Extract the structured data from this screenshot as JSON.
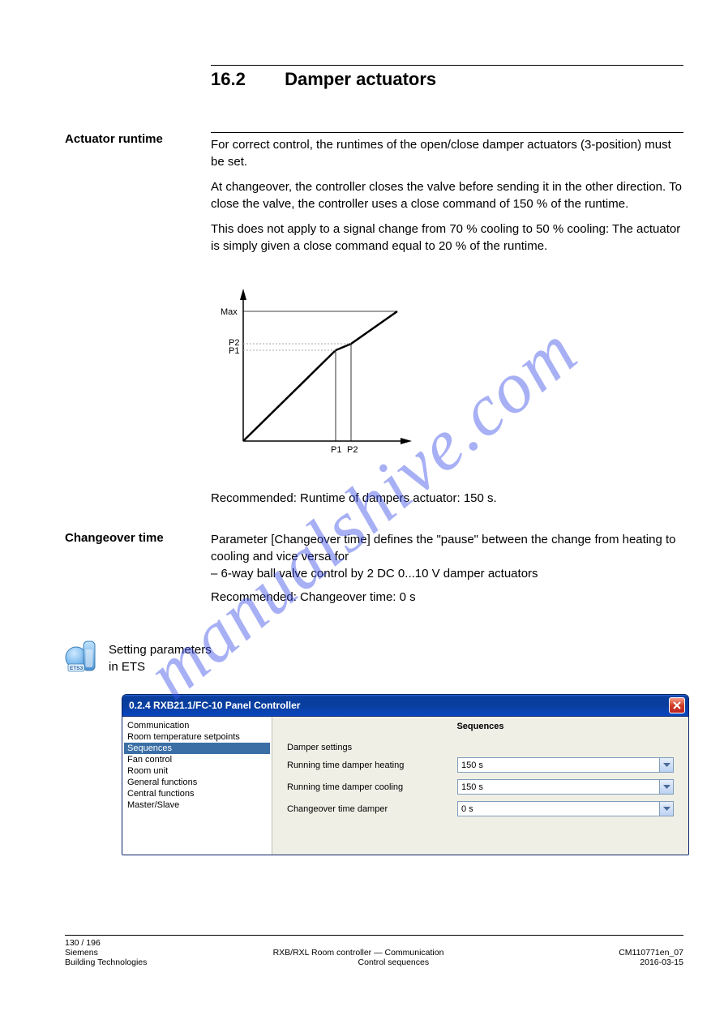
{
  "section": {
    "number": "16.2",
    "title": "Damper actuators"
  },
  "left_labels": {
    "runtime": "Actuator runtime",
    "changeover": "Changeover time",
    "tool_label": "Setting parameters\nin ETS"
  },
  "body": {
    "runtime": "For correct control, the runtimes of the open/close damper actuators (3-position) must be set.",
    "warning_1": "At changeover, the controller closes the valve before sending it in the other direction. To close the valve, the controller uses a close command of 150 % of the runtime.",
    "warning_2": "This does not apply to a signal change from 70 % cooling to 50 % cooling: The actuator is simply given a close command equal to 20 % of the runtime.",
    "recommend_note": "Recommended: Runtime of dampers actuator: 150 s.",
    "changeover_param": "Parameter [Changeover time] defines the \"pause\" between the change from heating to cooling and vice versa for",
    "changeover_item": "– 6-way ball valve control by 2 DC 0...10 V damper actuators",
    "recommend_change": "Recommended: Changeover time: 0 s"
  },
  "chart_data": {
    "type": "line",
    "title": "",
    "xlabel": "",
    "ylabel": "",
    "x": [
      0,
      60,
      70,
      100
    ],
    "y": [
      0,
      70,
      75,
      100
    ],
    "annotations": [
      "P1",
      "P2"
    ],
    "ylim": [
      0,
      100
    ],
    "xlim": [
      0,
      100
    ],
    "note": "P1 at ~(60,70), P2 at ~(70,75); dashed guides from axes to P1 and near-P2; Max band at top"
  },
  "dialog": {
    "title": "0.2.4 RXB21.1/FC-10 Panel Controller",
    "panel_title": "Sequences",
    "group_label": "Damper settings",
    "sidebar_items": [
      "Communication",
      "Room temperature setpoints",
      "Sequences",
      "Fan control",
      "Room unit",
      "General functions",
      "Central functions",
      "Master/Slave"
    ],
    "selected_index": 2,
    "fields": [
      {
        "label": "Running time damper heating",
        "value": "150 s"
      },
      {
        "label": "Running time damper cooling",
        "value": "150 s"
      },
      {
        "label": "Changeover time damper",
        "value": "0 s"
      }
    ]
  },
  "footer": {
    "left": "130 / 196",
    "center_line1": "Siemens",
    "center_line2": "Building Technologies",
    "right_line1": "RXB/RXL Room controller — Communication",
    "right_line2": "Control sequences",
    "doc_id": "CM110771en_07",
    "date": "2016-03-15"
  }
}
